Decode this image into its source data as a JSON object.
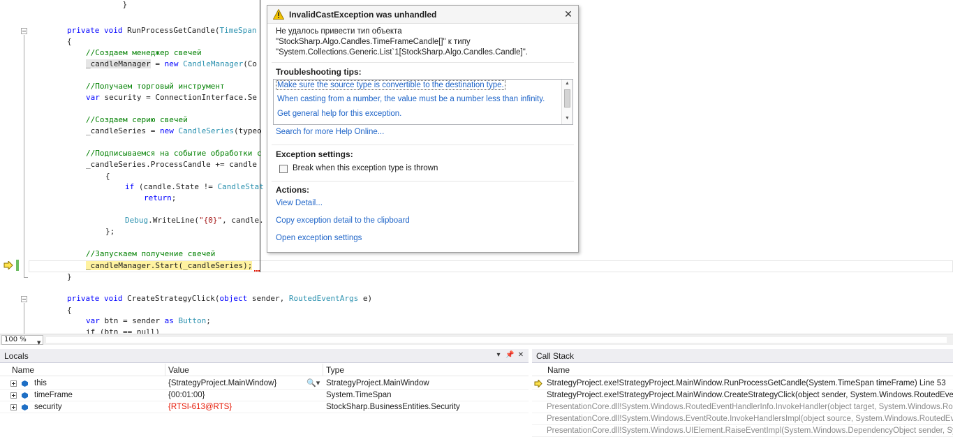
{
  "editor": {
    "lines": {
      "l0": "            }",
      "l1_kw": "private void ",
      "l1_name": "RunProcessGetCandle(",
      "l1_type": "TimeSpan",
      "l2": "{",
      "l3": "//Создаем менеджер свечей",
      "l4_var": "_candleManager",
      "l4_mid": " = ",
      "l4_kw": "new ",
      "l4_type": "CandleManager",
      "l4_rest": "(Co",
      "l5": "//Получаем торговый инструмент",
      "l6_kw": "var ",
      "l6_rest": "security = ConnectionInterface.Se",
      "l7": "//Создаем серию свечей",
      "l8_a": "_candleSeries = ",
      "l8_kw": "new ",
      "l8_type": "CandleSeries",
      "l8_b": "(typeo",
      "l9": "//Подписываемся на событие обработки с",
      "l10": "_candleSeries.ProcessCandle += candle",
      "l11": "{",
      "l12_kw": "if ",
      "l12_a": "(candle.State != ",
      "l12_type": "CandleStat",
      "l13_kw": "return",
      "l13_b": ";",
      "l14_type": "Debug",
      "l14_a": ".WriteLine(",
      "l14_str": "\"{0}\"",
      "l14_b": ", candle.",
      "l15": "};",
      "l16": "//Запускаем получение свечей",
      "l17": "_candleManager.Start(_candleSeries);",
      "l18": "}",
      "l19_kw": "private void ",
      "l19_name": "CreateStrategyClick(",
      "l19_kw2": "object ",
      "l19_b": "sender, ",
      "l19_type": "RoutedEventArgs",
      "l19_c": " e)",
      "l20": "{",
      "l21_kw": "var ",
      "l21_a": "btn = sender ",
      "l21_kw2": "as ",
      "l21_type": "Button",
      "l21_b": ";",
      "l22": "if (btn == null)"
    },
    "zoom": "100 %"
  },
  "exception": {
    "title": "InvalidCastException was unhandled",
    "message": [
      "Не удалось привести тип объекта",
      "\"StockSharp.Algo.Candles.TimeFrameCandle[]\" к типу",
      "\"System.Collections.Generic.List`1[StockSharp.Algo.Candles.Candle]\"."
    ],
    "tips_header": "Troubleshooting tips:",
    "tips": [
      "Make sure the source type is convertible to the destination type.",
      "When casting from a number, the value must be a number less than infinity.",
      "Get general help for this exception."
    ],
    "search_link": "Search for more Help Online...",
    "settings_header": "Exception settings:",
    "break_label": "Break when this exception type is thrown",
    "actions_header": "Actions:",
    "actions": [
      "View Detail...",
      "Copy exception detail to the clipboard",
      "Open exception settings"
    ]
  },
  "locals": {
    "title": "Locals",
    "columns": [
      "Name",
      "Value",
      "Type"
    ],
    "rows": [
      {
        "name": "this",
        "value": "{StrategyProject.MainWindow}",
        "type": "StrategyProject.MainWindow"
      },
      {
        "name": "timeFrame",
        "value": "{00:01:00}",
        "type": "System.TimeSpan"
      },
      {
        "name": "security",
        "value": "{RTSI-613@RTS}",
        "type": "StockSharp.BusinessEntities.Security"
      }
    ]
  },
  "callstack": {
    "title": "Call Stack",
    "columns": [
      "Name"
    ],
    "rows": [
      "StrategyProject.exe!StrategyProject.MainWindow.RunProcessGetCandle(System.TimeSpan timeFrame) Line 53",
      "StrategyProject.exe!StrategyProject.MainWindow.CreateStrategyClick(object sender, System.Windows.RoutedEventArgs e)",
      "PresentationCore.dll!System.Windows.RoutedEventHandlerInfo.InvokeHandler(object target, System.Windows.RoutedEventArgs routedEventArgs)",
      "PresentationCore.dll!System.Windows.EventRoute.InvokeHandlersImpl(object source, System.Windows.RoutedEventArgs args, bool reRaised)",
      "PresentationCore.dll!System.Windows.UIElement.RaiseEventImpl(System.Windows.DependencyObject sender, System.Windows.RoutedEventArgs args)"
    ]
  },
  "colors": {
    "keyword": "#0000ff",
    "type": "#2b91af",
    "comment": "#008000",
    "string": "#a31515",
    "link": "#1e64c8",
    "highlight": "#fff2a0",
    "warning": "#f2c200"
  }
}
